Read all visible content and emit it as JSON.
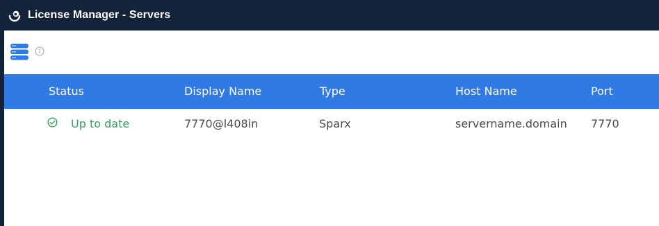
{
  "window": {
    "title": "License Manager - Servers"
  },
  "icons": {
    "app": "app-logo-icon",
    "servers": "server-list-icon",
    "info": "info-icon",
    "status_ok": "check-circle-icon"
  },
  "colors": {
    "titlebar": "#13233a",
    "header": "#2f7ae5",
    "status_ok": "#2fa35d",
    "icon_blue": "#2f7ae5"
  },
  "grid": {
    "columns": [
      "Status",
      "Display Name",
      "Type",
      "Host Name",
      "Port"
    ],
    "rows": [
      {
        "status": "Up to date",
        "display_name": "7770@l408in",
        "type": "Sparx",
        "host_name": "servername.domain",
        "port": "7770"
      }
    ]
  }
}
